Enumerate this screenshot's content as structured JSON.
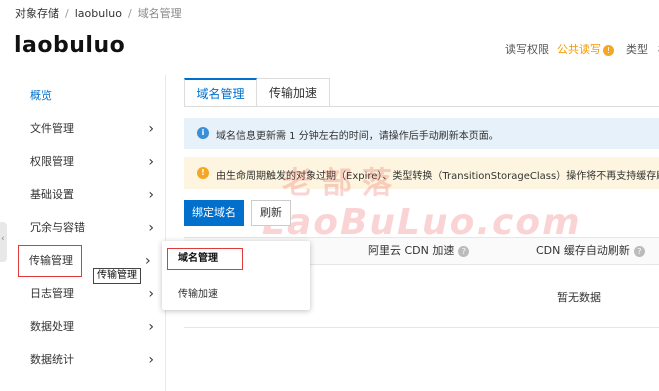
{
  "breadcrumb": {
    "root": "对象存储",
    "bucket": "laobuluo",
    "current": "域名管理",
    "separator": "/"
  },
  "page_title": "laobuluo",
  "header_right": {
    "perm_label": "读写权限",
    "perm_value": "公共读写",
    "type_label": "类型",
    "type_value": "标"
  },
  "sidebar": {
    "items": [
      {
        "label": "概览"
      },
      {
        "label": "文件管理"
      },
      {
        "label": "权限管理"
      },
      {
        "label": "基础设置"
      },
      {
        "label": "冗余与容错"
      },
      {
        "label": "传输管理"
      },
      {
        "label": "日志管理"
      },
      {
        "label": "数据处理"
      },
      {
        "label": "数据统计"
      }
    ]
  },
  "tooltip": "传输管理",
  "flyout": {
    "items": [
      {
        "label": "域名管理"
      },
      {
        "label": "传输加速"
      }
    ]
  },
  "tabs": [
    {
      "label": "域名管理"
    },
    {
      "label": "传输加速"
    }
  ],
  "notices": {
    "info": "域名信息更新需 1 分钟左右的时间，请操作后手动刷新本页面。",
    "warning": "由生命周期触发的对象过期（Expire）、类型转换（TransitionStorageClass）操作将不再支持缓存刷"
  },
  "buttons": {
    "bind_domain": "绑定域名",
    "refresh": "刷新"
  },
  "table": {
    "columns": [
      {
        "label": "阿里云 CDN 加速"
      },
      {
        "label": "CDN 缓存自动刷新"
      }
    ],
    "empty_text": "暂无数据"
  },
  "watermark": {
    "line1": "老部落",
    "line2": "LaoBuLuo.com"
  },
  "colors": {
    "accent": "#0070cc",
    "highlight": "#e03a3a",
    "warning": "#f5a623"
  }
}
